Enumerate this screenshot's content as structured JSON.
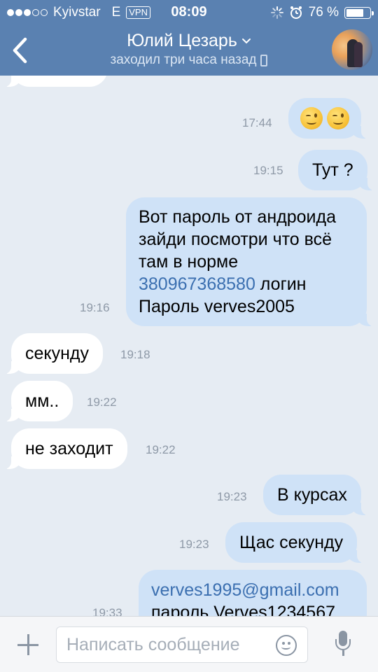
{
  "status_bar": {
    "carrier": "Kyivstar",
    "network": "E",
    "vpn": "VPN",
    "time": "08:09",
    "battery_text": "76 %",
    "battery_level": 0.76
  },
  "header": {
    "contact_name": "Юлий Цезарь",
    "last_seen": "заходил три часа назад"
  },
  "messages": [
    {
      "dir": "out",
      "time": "17:44"
    },
    {
      "dir": "out",
      "text": "Тут ?",
      "time": "19:15"
    },
    {
      "dir": "out",
      "lines": [
        "Вот пароль от андроида",
        "зайди посмотри что всё",
        "там в норме"
      ],
      "phone": "380967368580",
      "phone_suffix": " логин",
      "last_line": "Пароль verves2005",
      "time": "19:16"
    },
    {
      "dir": "in",
      "text": "секунду",
      "time": "19:18"
    },
    {
      "dir": "in",
      "text": "мм..",
      "time": "19:22"
    },
    {
      "dir": "in",
      "text": "не заходит",
      "time": "19:22"
    },
    {
      "dir": "out",
      "text": "В курсах",
      "time": "19:23"
    },
    {
      "dir": "out",
      "text": "Щас секунду",
      "time": "19:23"
    },
    {
      "dir": "out",
      "email": "verves1995@gmail.com",
      "text": "пароль Verves1234567",
      "time": "19:33"
    }
  ],
  "input": {
    "placeholder": "Написать сообщение"
  },
  "colors": {
    "header_bg": "#5a81b1",
    "chat_bg": "#e6ecf3",
    "outgoing_bubble": "#cfe2f7",
    "incoming_bubble": "#ffffff",
    "link": "#3b6fb0"
  },
  "icons": [
    "back-chevron-icon",
    "dropdown-chevron-icon",
    "phone-icon",
    "plus-icon",
    "smile-icon",
    "microphone-icon",
    "wink-emoji-icon"
  ]
}
